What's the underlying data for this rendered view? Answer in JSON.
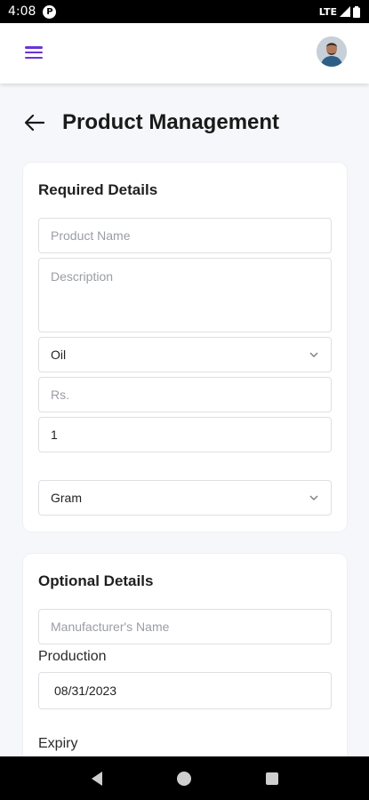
{
  "status_bar": {
    "time": "4:08",
    "network": "LTE",
    "app_icon_letter": "P"
  },
  "header": {
    "title": "Product Management"
  },
  "required": {
    "title": "Required Details",
    "product_name_placeholder": "Product Name",
    "description_placeholder": "Description",
    "category_value": "Oil",
    "price_placeholder": "Rs.",
    "quantity_value": "1",
    "unit_value": "Gram"
  },
  "optional": {
    "title": "Optional Details",
    "manufacturer_placeholder": "Manufacturer's Name",
    "production_label": "Production",
    "production_date": "08/31/2023",
    "expiry_label": "Expiry"
  },
  "colors": {
    "accent": "#6a33d9",
    "background": "#f6f7fa"
  },
  "icons": {
    "menu": "hamburger-icon",
    "back": "arrow-left-icon",
    "dropdown": "chevron-down-icon",
    "nav_back": "triangle-back-icon",
    "nav_home": "circle-home-icon",
    "nav_recents": "square-recents-icon"
  }
}
